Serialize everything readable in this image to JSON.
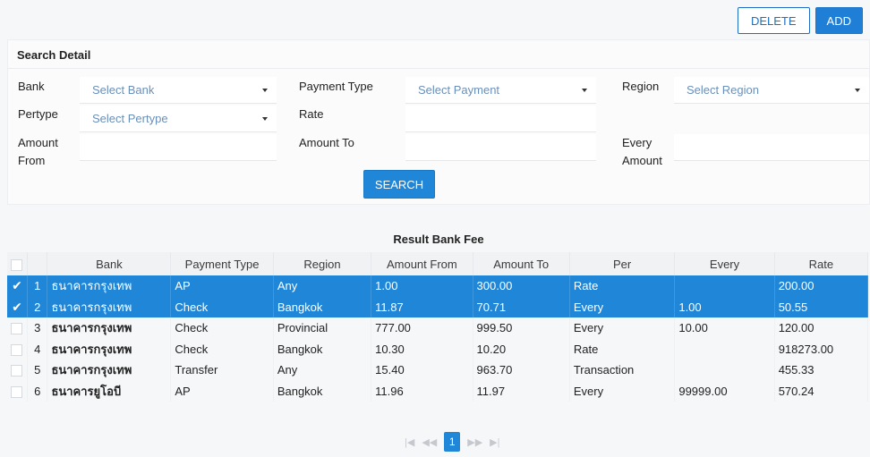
{
  "actions": {
    "delete_label": "DELETE",
    "add_label": "ADD"
  },
  "search": {
    "title": "Search Detail",
    "bank": {
      "label": "Bank",
      "placeholder": "Select Bank"
    },
    "payment_type": {
      "label": "Payment Type",
      "placeholder": "Select Payment"
    },
    "region": {
      "label": "Region",
      "placeholder": "Select Region"
    },
    "pertype": {
      "label": "Pertype",
      "placeholder": "Select Pertype"
    },
    "rate": {
      "label": "Rate",
      "value": ""
    },
    "amount_from": {
      "label_line1": "Amount",
      "label_line2": "From",
      "value": ""
    },
    "amount_to": {
      "label": "Amount To",
      "value": ""
    },
    "every_amount": {
      "label_line1": "Every",
      "label_line2": "Amount",
      "value": ""
    },
    "button_label": "SEARCH"
  },
  "results": {
    "title": "Result Bank Fee",
    "columns": [
      "Bank",
      "Payment Type",
      "Region",
      "Amount From",
      "Amount To",
      "Per",
      "Every",
      "Rate"
    ],
    "rows": [
      {
        "no": "1",
        "selected": true,
        "bank": "ธนาคารกรุงเทพ",
        "payment_type": "AP",
        "region": "Any",
        "amount_from": "1.00",
        "amount_to": "300.00",
        "per": "Rate",
        "every": "",
        "rate": "200.00"
      },
      {
        "no": "2",
        "selected": true,
        "bank": "ธนาคารกรุงเทพ",
        "payment_type": "Check",
        "region": "Bangkok",
        "amount_from": "11.87",
        "amount_to": "70.71",
        "per": "Every",
        "every": "1.00",
        "rate": "50.55"
      },
      {
        "no": "3",
        "selected": false,
        "bank": "ธนาคารกรุงเทพ",
        "payment_type": "Check",
        "region": "Provincial",
        "amount_from": "777.00",
        "amount_to": "999.50",
        "per": "Every",
        "every": "10.00",
        "rate": "120.00"
      },
      {
        "no": "4",
        "selected": false,
        "bank": "ธนาคารกรุงเทพ",
        "payment_type": "Check",
        "region": "Bangkok",
        "amount_from": "10.30",
        "amount_to": "10.20",
        "per": "Rate",
        "every": "",
        "rate": "918273.00"
      },
      {
        "no": "5",
        "selected": false,
        "bank": "ธนาคารกรุงเทพ",
        "payment_type": "Transfer",
        "region": "Any",
        "amount_from": "15.40",
        "amount_to": "963.70",
        "per": "Transaction",
        "every": "",
        "rate": "455.33"
      },
      {
        "no": "6",
        "selected": false,
        "bank": "ธนาคารยูโอบี",
        "payment_type": "AP",
        "region": "Bangkok",
        "amount_from": "11.96",
        "amount_to": "11.97",
        "per": "Every",
        "every": "99999.00",
        "rate": "570.24"
      }
    ]
  },
  "pagination": {
    "first": "|◀",
    "prev": "◀◀",
    "current": "1",
    "next": "▶▶",
    "last": "▶|"
  },
  "colors": {
    "accent": "#1f86d8",
    "selected_row": "#1f86d8",
    "placeholder": "#6a8fb8"
  }
}
